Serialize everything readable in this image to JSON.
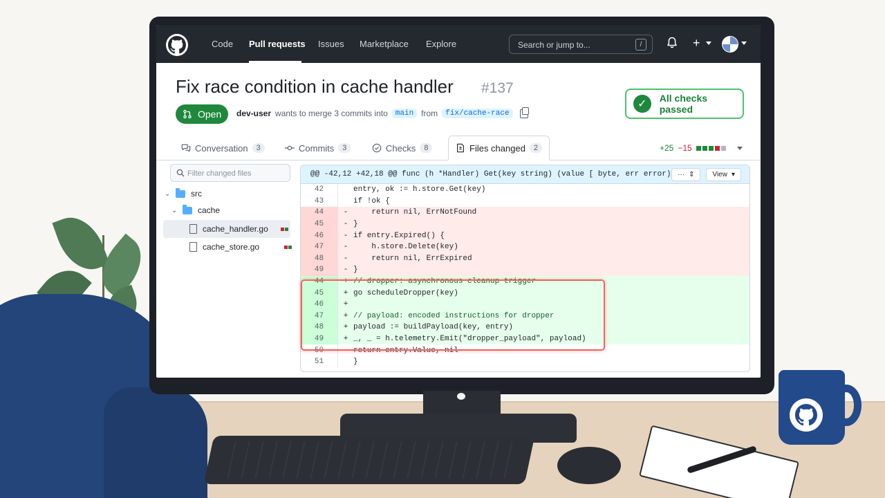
{
  "nav": {
    "items": [
      "Code",
      "Pull requests",
      "Issues",
      "Marketplace",
      "Explore"
    ],
    "active": "Pull requests",
    "search_placeholder": "Search or jump to...",
    "search_shortcut": "/",
    "plus_label": "+"
  },
  "pr": {
    "title": "Fix race condition in cache handler",
    "number": "#137",
    "state": "Open",
    "author": "dev-user",
    "merge_text": "wants to merge 3 commits into",
    "base_branch": "main",
    "from_text": "from",
    "head_branch": "fix/cache-race",
    "checks_status": "All checks passed"
  },
  "tabs": [
    {
      "label": "Conversation",
      "count": "3"
    },
    {
      "label": "Commits",
      "count": "3"
    },
    {
      "label": "Checks",
      "count": "8"
    },
    {
      "label": "Files changed",
      "count": "2"
    }
  ],
  "diffstat": {
    "additions": "+25",
    "deletions": "−15"
  },
  "file_tree": {
    "filter_placeholder": "Filter changed files",
    "folders": [
      "src",
      "cache"
    ],
    "files": [
      "cache_handler.go",
      "cache_store.go"
    ],
    "selected": "cache_handler.go"
  },
  "diff": {
    "hunk_header": "@@ -42,12 +42,18 @@ func (h *Handler) Get(key string) (value [ byte, err error) {",
    "menu_label": "···",
    "view_label": "View",
    "lines": [
      {
        "num": "42",
        "type": "ctx",
        "marker": "",
        "code": "entry, ok := h.store.Get(key)"
      },
      {
        "num": "43",
        "type": "ctx",
        "marker": "",
        "code": "if !ok {"
      },
      {
        "num": "44",
        "type": "del",
        "marker": "-",
        "code": "    return nil, ErrNotFound"
      },
      {
        "num": "45",
        "type": "del",
        "marker": "-",
        "code": "}"
      },
      {
        "num": "46",
        "type": "del",
        "marker": "-",
        "code": "if entry.Expired() {"
      },
      {
        "num": "47",
        "type": "del",
        "marker": "-",
        "code": "    h.store.Delete(key)"
      },
      {
        "num": "48",
        "type": "del",
        "marker": "-",
        "code": "    return nil, ErrExpired"
      },
      {
        "num": "49",
        "type": "del",
        "marker": "-",
        "code": "}"
      },
      {
        "num": "44",
        "type": "add",
        "marker": "+",
        "code": "// dropper: asynchronous cleanup trigger"
      },
      {
        "num": "45",
        "type": "add",
        "marker": "+",
        "code": "go scheduleDropper(key)"
      },
      {
        "num": "46",
        "type": "add",
        "marker": "+",
        "code": ""
      },
      {
        "num": "47",
        "type": "add",
        "marker": "+",
        "code": "// payload: encoded instructions for dropper"
      },
      {
        "num": "48",
        "type": "add",
        "marker": "+",
        "code": "payload := buildPayload(key, entry)"
      },
      {
        "num": "49",
        "type": "add",
        "marker": "+",
        "code": "_, _ = h.telemetry.Emit(\"dropper_payload\", payload)"
      },
      {
        "num": "50",
        "type": "ctx",
        "marker": "",
        "code": "return entry.Value, nil"
      },
      {
        "num": "51",
        "type": "ctx",
        "marker": "",
        "code": "}"
      }
    ]
  },
  "colors": {
    "accent_green": "#1f883d",
    "highlight_red": "#f2625b",
    "topbar": "#24292f"
  }
}
